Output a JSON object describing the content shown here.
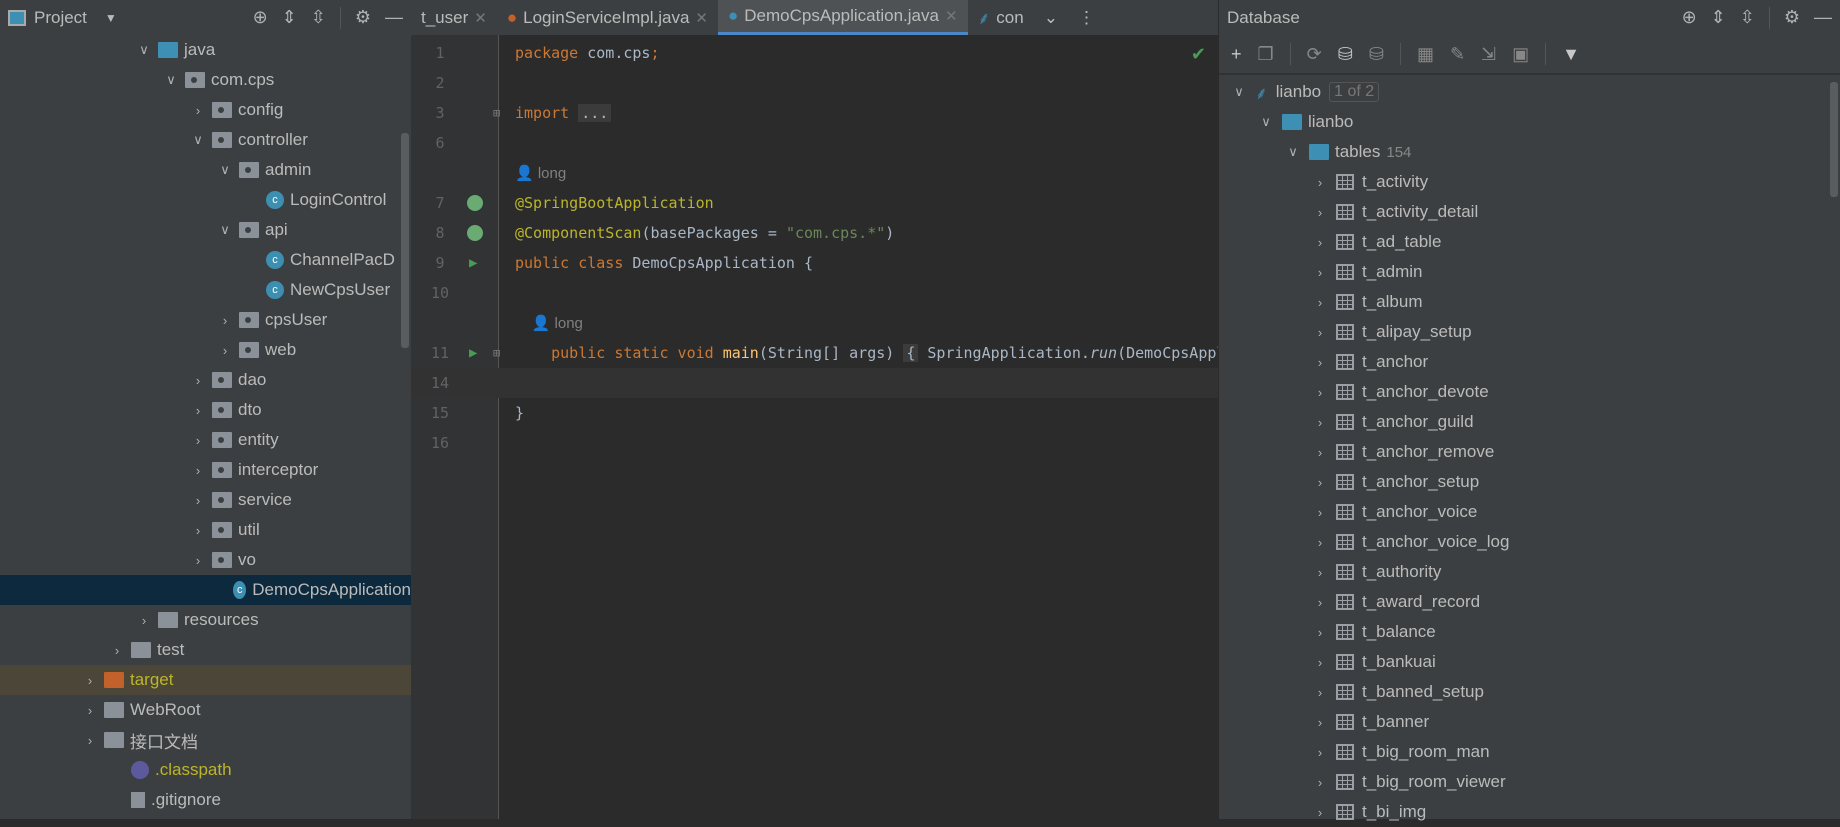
{
  "project": {
    "title": "Project",
    "tree": [
      {
        "label": "java",
        "level": 2,
        "chev": "down",
        "icon": "folder-blue"
      },
      {
        "label": "com.cps",
        "level": 3,
        "chev": "down",
        "icon": "package"
      },
      {
        "label": "config",
        "level": 4,
        "chev": "right",
        "icon": "package"
      },
      {
        "label": "controller",
        "level": 4,
        "chev": "down",
        "icon": "package"
      },
      {
        "label": "admin",
        "level": 5,
        "chev": "down",
        "icon": "package"
      },
      {
        "label": "LoginControl",
        "level": 6,
        "chev": "",
        "icon": "class"
      },
      {
        "label": "api",
        "level": 5,
        "chev": "down",
        "icon": "package"
      },
      {
        "label": "ChannelPacD",
        "level": 6,
        "chev": "",
        "icon": "class"
      },
      {
        "label": "NewCpsUser",
        "level": 6,
        "chev": "",
        "icon": "class"
      },
      {
        "label": "cpsUser",
        "level": 5,
        "chev": "right",
        "icon": "package"
      },
      {
        "label": "web",
        "level": 5,
        "chev": "right",
        "icon": "package"
      },
      {
        "label": "dao",
        "level": 4,
        "chev": "right",
        "icon": "package"
      },
      {
        "label": "dto",
        "level": 4,
        "chev": "right",
        "icon": "package"
      },
      {
        "label": "entity",
        "level": 4,
        "chev": "right",
        "icon": "package"
      },
      {
        "label": "interceptor",
        "level": 4,
        "chev": "right",
        "icon": "package"
      },
      {
        "label": "service",
        "level": 4,
        "chev": "right",
        "icon": "package"
      },
      {
        "label": "util",
        "level": 4,
        "chev": "right",
        "icon": "package"
      },
      {
        "label": "vo",
        "level": 4,
        "chev": "right",
        "icon": "package"
      },
      {
        "label": "DemoCpsApplication",
        "level": 5,
        "chev": "",
        "icon": "spring-class",
        "selected": true
      },
      {
        "label": "resources",
        "level": 2,
        "chev": "right",
        "icon": "folder"
      },
      {
        "label": "test",
        "level": 1,
        "chev": "right",
        "icon": "folder"
      },
      {
        "label": "target",
        "level": 0,
        "chev": "right",
        "icon": "folder-orange",
        "highlight": true
      },
      {
        "label": "WebRoot",
        "level": 0,
        "chev": "right",
        "icon": "folder"
      },
      {
        "label": "接口文档",
        "level": 0,
        "chev": "right",
        "icon": "folder"
      },
      {
        "label": ".classpath",
        "level": 1,
        "chev": "",
        "icon": "eclipse",
        "yellow": true
      },
      {
        "label": ".gitignore",
        "level": 1,
        "chev": "",
        "icon": "file"
      }
    ]
  },
  "editor": {
    "tabs": [
      {
        "label": "t_user",
        "active": false
      },
      {
        "label": "LoginServiceImpl.java",
        "active": false
      },
      {
        "label": "DemoCpsApplication.java",
        "active": true
      },
      {
        "label": "con",
        "active": false
      }
    ],
    "lines": [
      {
        "n": "1",
        "tokens": [
          [
            "kw",
            "package "
          ],
          [
            "",
            "com.cps"
          ],
          [
            "kw",
            ";"
          ]
        ]
      },
      {
        "n": "2",
        "tokens": []
      },
      {
        "n": "3",
        "fold": true,
        "tokens": [
          [
            "kw",
            "import "
          ],
          [
            "fold",
            "..."
          ]
        ]
      },
      {
        "n": "6",
        "tokens": []
      },
      {
        "n": "",
        "tokens": [
          [
            "hint",
            "👤 long"
          ]
        ]
      },
      {
        "n": "7",
        "gutter": "spring",
        "tokens": [
          [
            "an",
            "@SpringBootApplication"
          ]
        ]
      },
      {
        "n": "8",
        "gutter": "spring",
        "tokens": [
          [
            "an",
            "@ComponentScan"
          ],
          [
            "",
            "(basePackages = "
          ],
          [
            "st",
            "\"com.cps.*\""
          ],
          [
            "",
            ")"
          ]
        ]
      },
      {
        "n": "9",
        "gutter": "run",
        "tokens": [
          [
            "kw",
            "public class "
          ],
          [
            "",
            "DemoCpsApplication {"
          ]
        ]
      },
      {
        "n": "10",
        "tokens": []
      },
      {
        "n": "",
        "tokens": [
          [
            "hint",
            "    👤 long"
          ]
        ]
      },
      {
        "n": "11",
        "gutter": "run",
        "fold": true,
        "tokens": [
          [
            "",
            "    "
          ],
          [
            "kw",
            "public static void "
          ],
          [
            "fn",
            "main"
          ],
          [
            "",
            "(String[] args) "
          ],
          [
            "fold",
            "{"
          ],
          [
            "",
            " SpringApplication."
          ],
          [
            "it",
            "run"
          ],
          [
            "",
            "(DemoCpsApplication.class, args); }"
          ]
        ]
      },
      {
        "n": "14",
        "current": true,
        "tokens": []
      },
      {
        "n": "15",
        "tokens": [
          [
            "",
            "}"
          ]
        ]
      },
      {
        "n": "16",
        "tokens": []
      }
    ]
  },
  "database": {
    "title": "Database",
    "connection": "lianbo",
    "connection_badge": "1 of 2",
    "schema": "lianbo",
    "tables_label": "tables",
    "tables_count": "154",
    "tables": [
      "t_activity",
      "t_activity_detail",
      "t_ad_table",
      "t_admin",
      "t_album",
      "t_alipay_setup",
      "t_anchor",
      "t_anchor_devote",
      "t_anchor_guild",
      "t_anchor_remove",
      "t_anchor_setup",
      "t_anchor_voice",
      "t_anchor_voice_log",
      "t_authority",
      "t_award_record",
      "t_balance",
      "t_bankuai",
      "t_banned_setup",
      "t_banner",
      "t_big_room_man",
      "t_big_room_viewer",
      "t_bi_img"
    ]
  },
  "colors": {
    "selection": "#0d293e",
    "keyword": "#cc7832",
    "annotation": "#bbb529",
    "string": "#6a8759",
    "accent": "#4a88c7"
  }
}
